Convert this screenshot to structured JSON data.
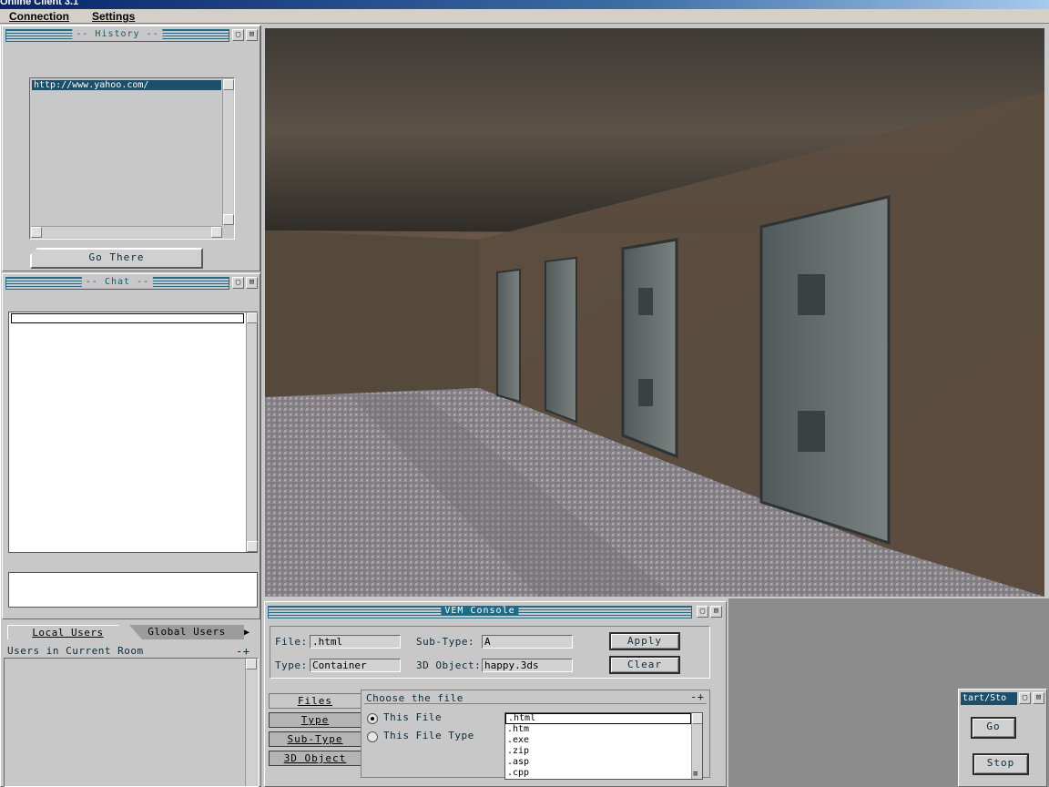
{
  "window": {
    "title": "Online Client 3.1"
  },
  "menu": {
    "connection": "Connection",
    "settings": "Settings"
  },
  "history": {
    "title": "-- History --",
    "items": [
      "http://www.yahoo.com/"
    ],
    "go_button": "Go There"
  },
  "chat": {
    "title": "-- Chat --"
  },
  "users": {
    "tab_local": "Local Users",
    "tab_global": "Global Users",
    "header": "Users in Current Room",
    "header_controls": "-+"
  },
  "vem": {
    "title": "VEM Console",
    "file_label": "File:",
    "file_value": ".html",
    "subtype_label": "Sub-Type:",
    "subtype_value": "A",
    "type_label": "Type:",
    "type_value": "Container",
    "object_label": "3D Object:",
    "object_value": "happy.3ds",
    "apply": "Apply",
    "clear": "Clear",
    "side_buttons": [
      "Files",
      "Type",
      "Sub-Type",
      "3D Object"
    ],
    "choose_title": "Choose the file",
    "choose_controls": "-+",
    "radio_this_file": "This File",
    "radio_this_type": "This File Type",
    "file_list": [
      ".html",
      ".htm",
      ".exe",
      ".zip",
      ".asp",
      ".cpp"
    ]
  },
  "startstop": {
    "title": "tart/Sto",
    "go": "Go",
    "stop": "Stop"
  },
  "colors": {
    "accent": "#1b6d8c",
    "panel": "#c8c8c8",
    "title_blue": "#08246b"
  },
  "icons": [
    "minimize-icon",
    "close-icon",
    "scroll-up-icon",
    "scroll-down-icon",
    "scroll-left-icon",
    "scroll-right-icon",
    "tab-arrow-icon"
  ]
}
